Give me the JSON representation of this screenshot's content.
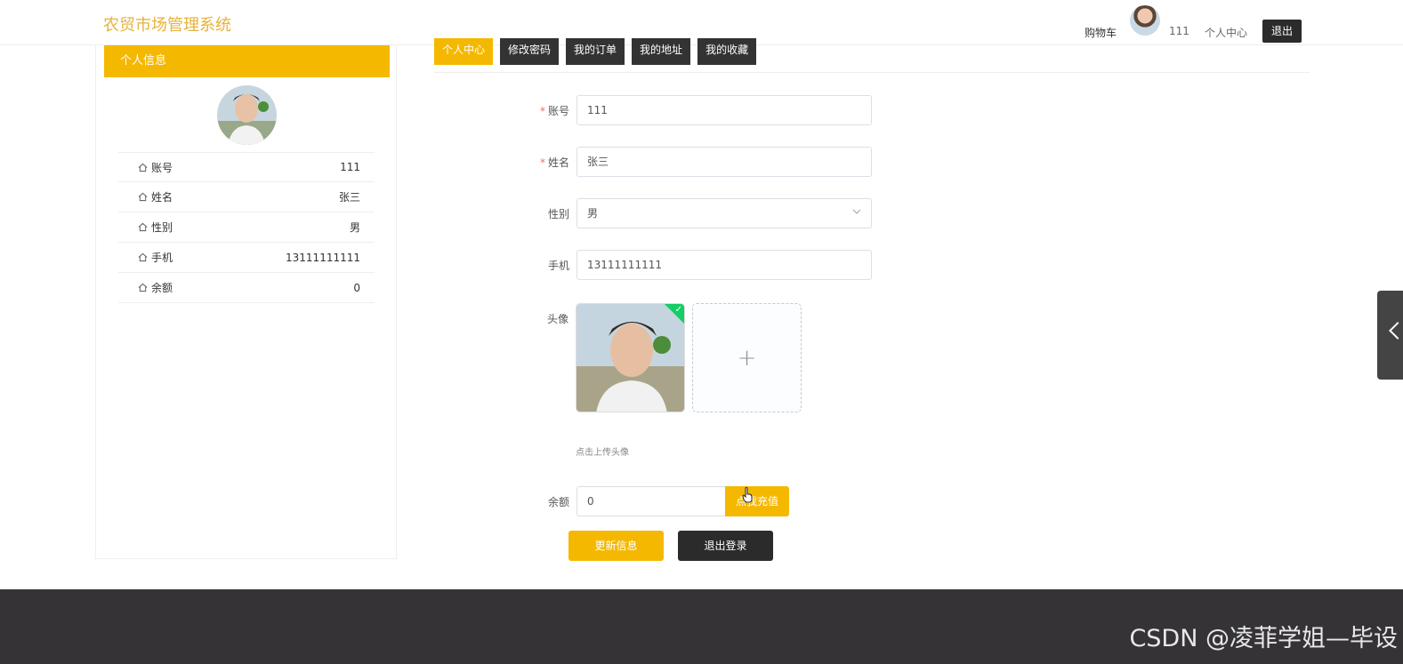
{
  "header": {
    "logo": "农贸市场管理系统",
    "cart": "购物车",
    "username": "111",
    "personal_center": "个人中心",
    "logout": "退出"
  },
  "left_panel": {
    "title": "个人信息",
    "rows": [
      {
        "label": "账号",
        "value": "111"
      },
      {
        "label": "姓名",
        "value": "张三"
      },
      {
        "label": "性别",
        "value": "男"
      },
      {
        "label": "手机",
        "value": "13111111111"
      },
      {
        "label": "余额",
        "value": "0"
      }
    ]
  },
  "tabs": [
    {
      "label": "个人中心",
      "active": true
    },
    {
      "label": "修改密码"
    },
    {
      "label": "我的订单"
    },
    {
      "label": "我的地址"
    },
    {
      "label": "我的收藏"
    }
  ],
  "form": {
    "account_label": "账号",
    "account_value": "111",
    "name_label": "姓名",
    "name_value": "张三",
    "gender_label": "性别",
    "gender_value": "男",
    "phone_label": "手机",
    "phone_value": "13111111111",
    "avatar_label": "头像",
    "upload_tip": "点击上传头像",
    "upload_plus": "+",
    "balance_label": "余额",
    "balance_value": "0",
    "recharge": "点我充值",
    "update_button": "更新信息",
    "logout_button": "退出登录"
  },
  "footer": {
    "watermark": "CSDN @凌菲学姐—毕设"
  },
  "colors": {
    "accent": "#f5b800",
    "dark": "#2b2b2b",
    "footer": "#353336"
  }
}
